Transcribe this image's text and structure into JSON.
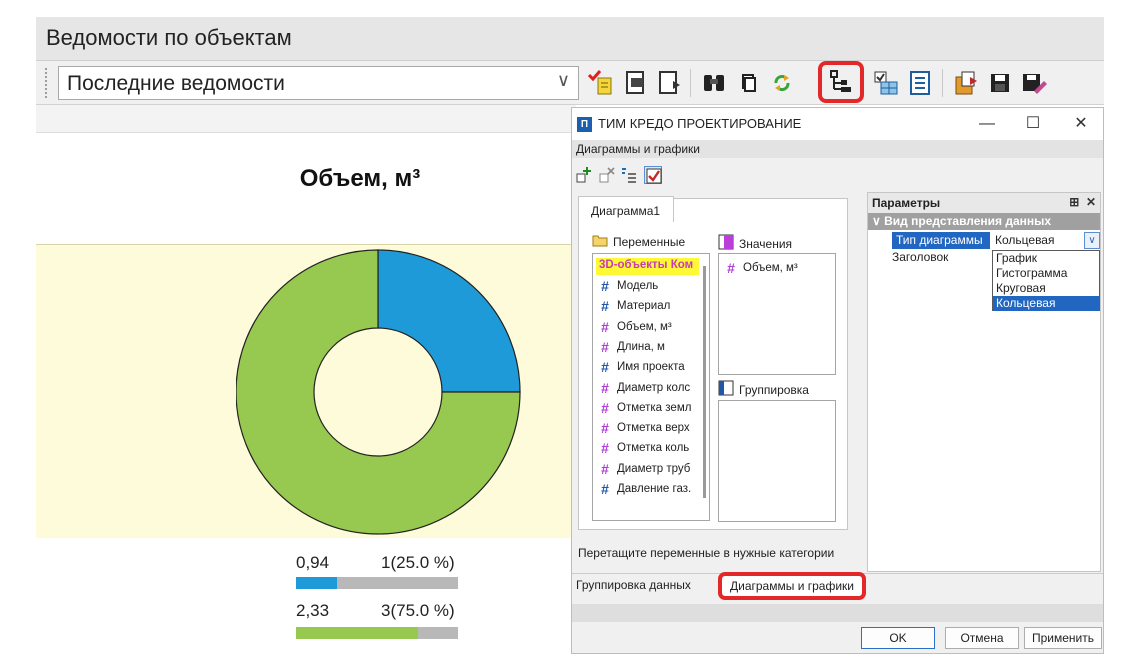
{
  "main": {
    "title": "Ведомости по объектам",
    "report_select": "Последние ведомости"
  },
  "chart": {
    "title": "Объем, м³",
    "legend": [
      {
        "value": "0,94",
        "count": "1(25.0 %)",
        "fraction": 0.25,
        "color": "#1f9ad9"
      },
      {
        "value": "2,33",
        "count": "3(75.0 %)",
        "fraction": 0.75,
        "color": "#97c84f"
      }
    ]
  },
  "chart_data": {
    "type": "pie",
    "title": "Объем, м³",
    "categories": [
      "0,94",
      "2,33"
    ],
    "values": [
      1,
      3
    ],
    "percent": [
      25.0,
      75.0
    ],
    "colors": [
      "#1f9ad9",
      "#97c84f"
    ],
    "donut": true
  },
  "dialog": {
    "app_title": "ТИМ КРЕДО ПРОЕКТИРОВАНИЕ",
    "app_icon_letter": "П",
    "subtitle": "Диаграммы и графики",
    "tab": "Диаграмма1",
    "variables_header": "Переменные",
    "values_header": "Значения",
    "grouping_header": "Группировка",
    "variables": [
      {
        "label": "3D-объекты Ком",
        "kind": "header"
      },
      {
        "label": "Модель",
        "kind": "text"
      },
      {
        "label": "Материал",
        "kind": "text"
      },
      {
        "label": "Объем, м³",
        "kind": "num"
      },
      {
        "label": "Длина, м",
        "kind": "num"
      },
      {
        "label": "Имя проекта",
        "kind": "text"
      },
      {
        "label": "Диаметр колс",
        "kind": "num"
      },
      {
        "label": "Отметка земл",
        "kind": "num"
      },
      {
        "label": "Отметка верх",
        "kind": "num"
      },
      {
        "label": "Отметка коль",
        "kind": "num"
      },
      {
        "label": "Диаметр труб",
        "kind": "num"
      },
      {
        "label": "Давление газ.",
        "kind": "text"
      }
    ],
    "values_items": [
      "Объем, м³"
    ],
    "hint": "Перетащите переменные в нужные категории",
    "bottom_tabs": [
      "Группировка данных",
      "Диаграммы и графики"
    ],
    "buttons": {
      "ok": "OK",
      "cancel": "Отмена",
      "apply": "Применить"
    },
    "params": {
      "header": "Параметры",
      "category": "Вид представления данных",
      "prop1_name": "Тип диаграммы",
      "prop1_value": "Кольцевая",
      "prop2_name": "Заголовок",
      "options": [
        "График",
        "Гистограмма",
        "Круговая",
        "Кольцевая"
      ],
      "selected_option": "Кольцевая"
    }
  }
}
